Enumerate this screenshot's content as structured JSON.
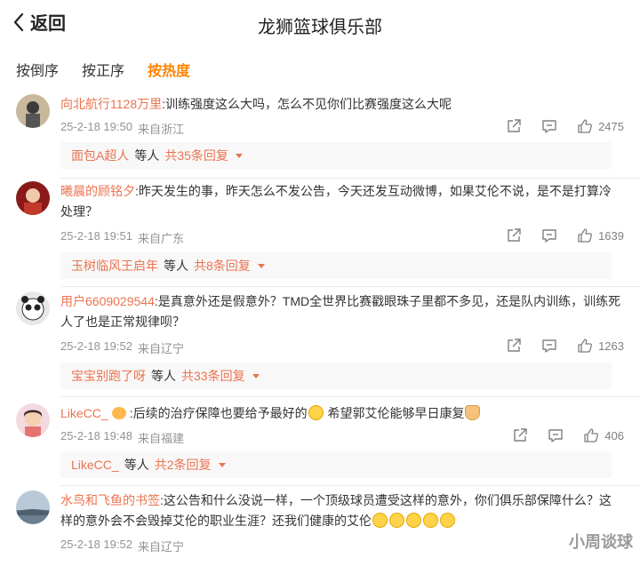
{
  "header": {
    "back_label": "返回",
    "title": "龙狮篮球俱乐部"
  },
  "sort_tabs": [
    {
      "label": "按倒序",
      "active": false
    },
    {
      "label": "按正序",
      "active": false
    },
    {
      "label": "按热度",
      "active": true
    }
  ],
  "colors": {
    "accent": "#ff8200",
    "username": "#eb7350",
    "meta": "#939393"
  },
  "icons": [
    "back-arrow-icon",
    "share-icon",
    "comment-icon",
    "like-icon",
    "expand-caret-icon"
  ],
  "comments": [
    {
      "user": "向北航行1128万里",
      "text": ":训练强度这么大吗，怎么不见你们比赛强度这么大呢",
      "time": "25-2-18 19:50",
      "source": "来自浙江",
      "likes": "2475",
      "reply": {
        "name": "面包A超人",
        "mid": "等人",
        "count": "共35条回复"
      }
    },
    {
      "user": "曦晨的顾铭夕",
      "text": ":昨天发生的事，昨天怎么不发公告，今天还发互动微博，如果艾伦不说，是不是打算冷处理？",
      "time": "25-2-18 19:51",
      "source": "来自广东",
      "likes": "1639",
      "reply": {
        "name": "玉树临风王启年",
        "mid": "等人",
        "count": "共8条回复"
      }
    },
    {
      "user": "用户6609029544",
      "text": ":是真意外还是假意外？TMD全世界比赛戳眼珠子里都不多见，还是队内训练，训练死人了也是正常规律呗？",
      "time": "25-2-18 19:52",
      "source": "来自辽宁",
      "likes": "1263",
      "reply": {
        "name": "宝宝别跑了呀",
        "mid": "等人",
        "count": "共33条回复"
      }
    },
    {
      "user": "LikeCC_",
      "text_a": ":后续的治疗保障也要给予最好的",
      "text_b": " 希望郭艾伦能够早日康复",
      "time": "25-2-18 19:48",
      "source": "来自福建",
      "likes": "406",
      "reply": {
        "name": "LikeCC_",
        "mid": "等人",
        "count": "共2条回复"
      }
    },
    {
      "user": "水鸟和飞鱼的书签",
      "text": ":这公告和什么没说一样，一个顶级球员遭受这样的意外，你们俱乐部保障什么？这样的意外会不会毁掉艾伦的职业生涯？还我们健康的艾伦",
      "time": "25-2-18 19:52",
      "source": "来自辽宁"
    }
  ],
  "watermark": "小周谈球"
}
